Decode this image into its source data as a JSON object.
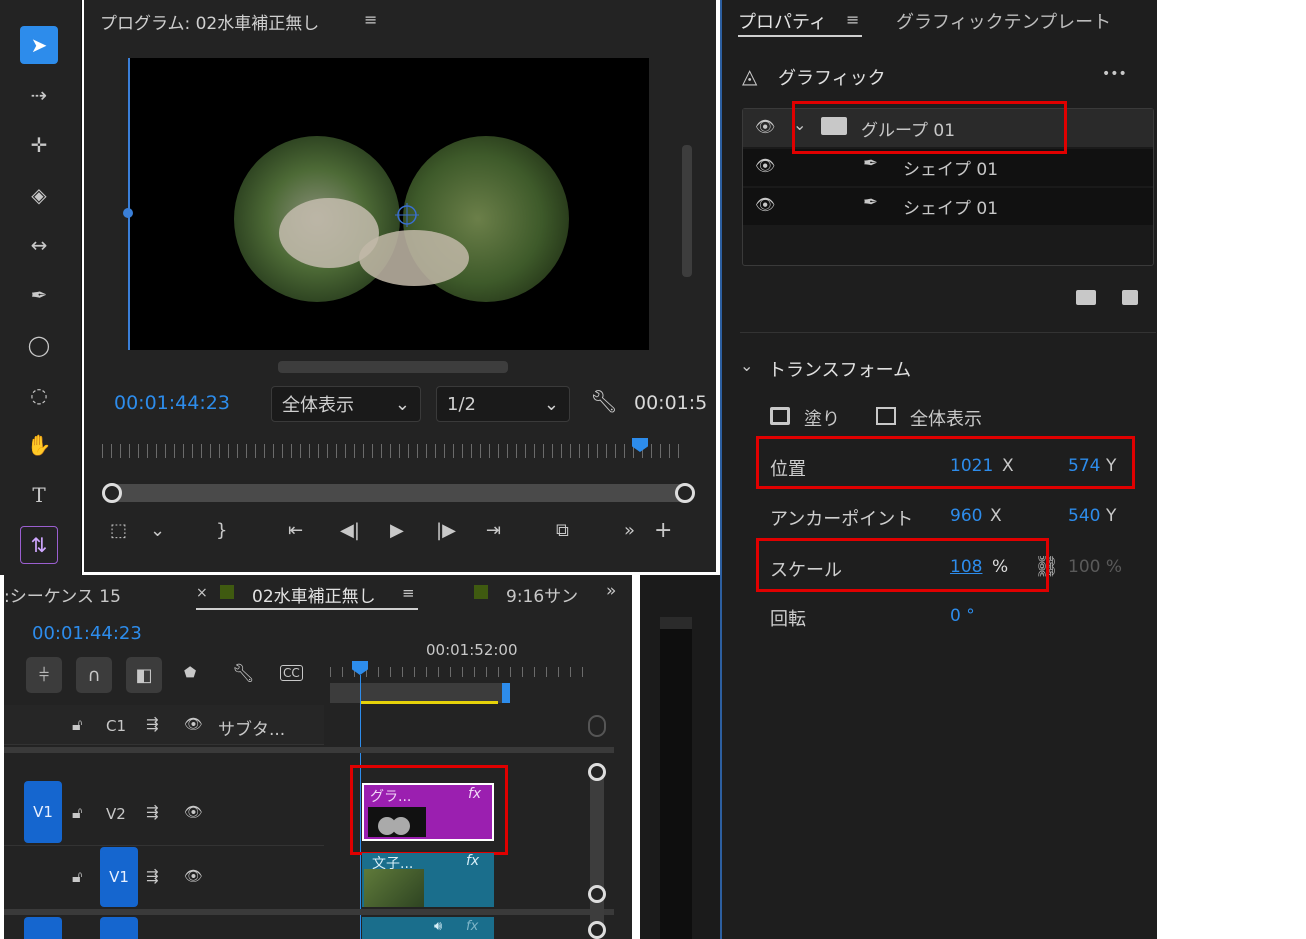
{
  "program_monitor": {
    "title": "プログラム: 02水車補正無し",
    "menu_icon": "hamburger-icon",
    "timecode": "00:01:44:23",
    "zoom_select": "全体表示",
    "resolution_select": "1/2",
    "end_timecode": "00:01:5"
  },
  "properties": {
    "tab_properties": "プロパティ",
    "tab_templates": "グラフィックテンプレート",
    "section_graphic": "グラフィック",
    "more": "•••",
    "layers": [
      {
        "name": "グループ 01",
        "type": "group"
      },
      {
        "name": "シェイプ 01",
        "type": "shape"
      },
      {
        "name": "シェイプ 01",
        "type": "shape"
      }
    ],
    "section_transform": "トランスフォーム",
    "fill_label": "塗り",
    "fit_label": "全体表示",
    "position_label": "位置",
    "position_x": "1021",
    "position_y": "574",
    "anchor_label": "アンカーポイント",
    "anchor_x": "960",
    "anchor_y": "540",
    "scale_label": "スケール",
    "scale_value": "108",
    "scale_unit": "%",
    "scale_height": "100 %",
    "rotation_label": "回転",
    "rotation_value": "0 °",
    "x_suffix": "X",
    "y_suffix": "Y"
  },
  "timeline": {
    "tab_sequence15": ":シーケンス 15",
    "tab_active": "02水車補正無し",
    "tab_next": "9:16サン",
    "timecode": "00:01:44:23",
    "ruler_time": "00:01:52:00",
    "tracks": {
      "c1": "C1",
      "c1_name": "サブタ...",
      "v2": "V2",
      "v1_src": "V1",
      "v1": "V1"
    },
    "clip_graphic": "グラ...",
    "clip_video": "文子...",
    "fx": "fx"
  },
  "colors": {
    "accent": "#2d8ceb",
    "highlight": "#e00000",
    "graphic_clip": "#9b1fb0",
    "video_clip": "#1a6e8c"
  }
}
